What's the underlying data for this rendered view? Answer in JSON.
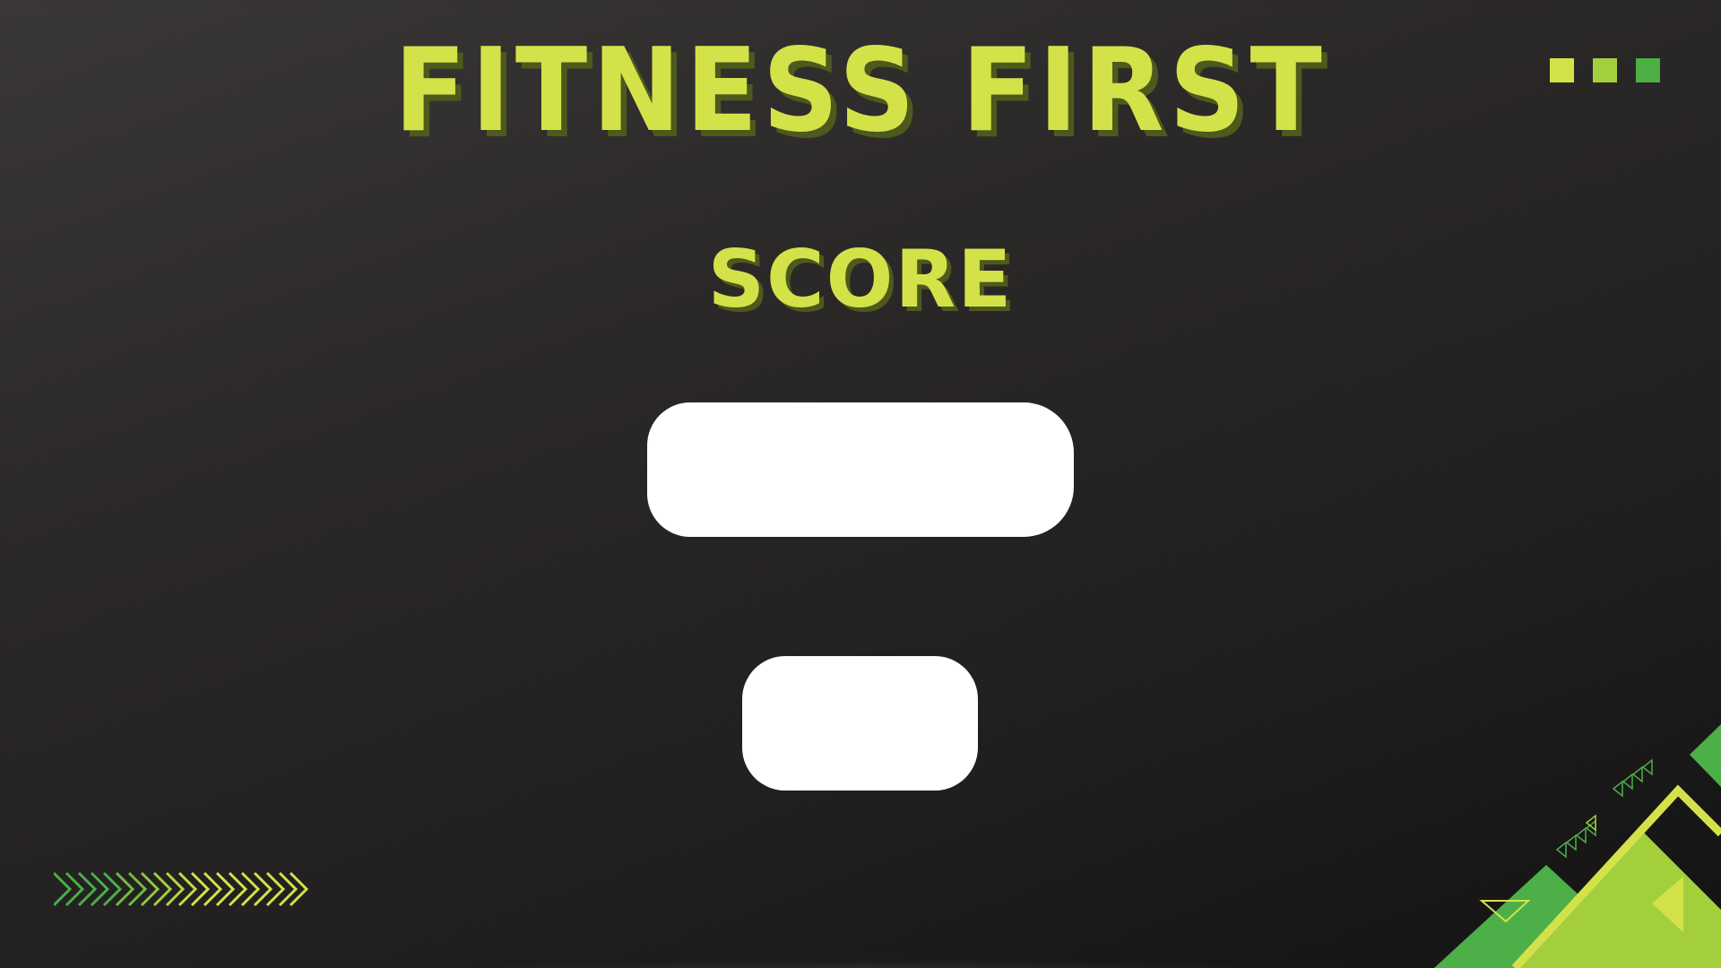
{
  "title": "FITNESS FIRST",
  "score_label": "SCORE",
  "score_box": {
    "value": ""
  },
  "action_box": {
    "label": ""
  },
  "colors": {
    "background": "#2b2828",
    "accent_yellow": "#d4e24a",
    "accent_lime": "#a3cf3d",
    "accent_green": "#4caf47",
    "title_shadow": "#4d5a1c",
    "box": "#ffffff"
  },
  "decor": {
    "window_dots": [
      "#d4e24a",
      "#a3cf3d",
      "#4caf47"
    ],
    "chevron_colors": [
      "#4caf47",
      "#d4e24a"
    ],
    "corner_icon": "triangle-corner-decoration",
    "chevron_icon": "double-chevron-decoration"
  }
}
